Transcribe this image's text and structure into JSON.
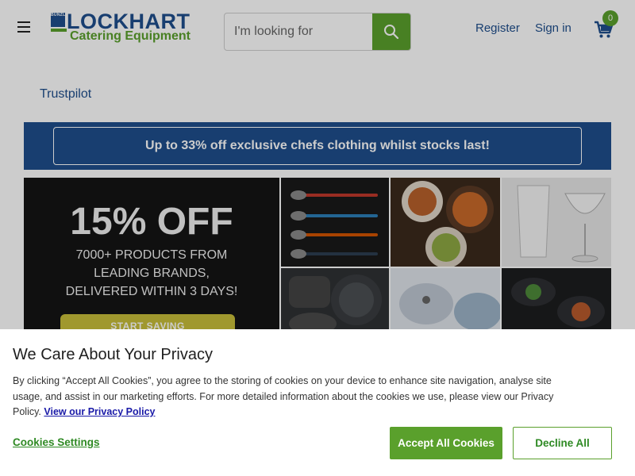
{
  "header": {
    "logo": {
      "brand": "LOCKHART",
      "tagline": "Catering Equipment",
      "badge": "BUNZL"
    },
    "search": {
      "placeholder": "I'm looking for"
    },
    "register_label": "Register",
    "signin_label": "Sign in",
    "cart_count": "0"
  },
  "trustpilot_label": "Trustpilot",
  "promo": {
    "label": "Up to 33% off exclusive chefs clothing whilst stocks last!"
  },
  "banner": {
    "headline": "15% OFF",
    "line1": "7000+ PRODUCTS FROM",
    "line2": "LEADING BRANDS,",
    "line3": "DELIVERED WITHIN 3 DAYS!",
    "cta": "START SAVING"
  },
  "privacy": {
    "title": "We Care About Your Privacy",
    "body": "By clicking “Accept All Cookies”, you agree to the storing of cookies on your device to enhance site navigation, analyse site usage, and assist in our marketing efforts. For more detailed information about the cookies we use, please view our Privacy Policy.",
    "policy_link": "View our Privacy Policy",
    "settings_label": "Cookies Settings",
    "accept_label": "Accept All Cookies",
    "decline_label": "Decline All"
  },
  "colors": {
    "brand_blue": "#1e4e8c",
    "brand_green": "#5aa02c"
  }
}
